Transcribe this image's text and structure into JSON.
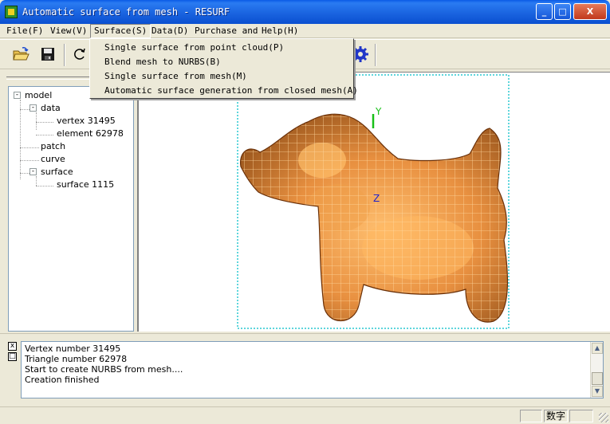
{
  "window": {
    "title": "Automatic surface from mesh - RESURF",
    "min_glyph": "_",
    "max_glyph": "□",
    "close_glyph": "X"
  },
  "menubar": {
    "items": [
      {
        "label": "File(F)"
      },
      {
        "label": "View(V)"
      },
      {
        "label": "Surface(S)"
      },
      {
        "label": "Data(D)"
      },
      {
        "label": "Purchase and"
      },
      {
        "label": "Help(H)"
      }
    ],
    "open_menu": "Surface(S)"
  },
  "surface_menu": {
    "items": [
      {
        "label": "Single surface from point cloud(P)"
      },
      {
        "label": "Blend mesh to NURBS(B)"
      },
      {
        "label": "Single surface from mesh(M)"
      },
      {
        "label": "Automatic surface generation from closed mesh(A)"
      }
    ]
  },
  "toolbar": {
    "buttons": [
      {
        "icon": "open-folder-icon"
      },
      {
        "icon": "save-disk-icon"
      },
      {
        "icon": "refresh-icon"
      },
      {
        "icon": "gear-icon"
      }
    ]
  },
  "tree": {
    "nodes": [
      {
        "label": "model",
        "expander": "-"
      },
      {
        "label": "data",
        "expander": "-"
      },
      {
        "label": "vertex 31495"
      },
      {
        "label": "element 62978"
      },
      {
        "label": "patch"
      },
      {
        "label": "curve"
      },
      {
        "label": "surface",
        "expander": "-"
      },
      {
        "label": "surface 1115"
      }
    ]
  },
  "viewport": {
    "axis_y": "Y",
    "axis_z": "Z",
    "colors": {
      "mesh": "#f0a04a",
      "mesh_dark": "#8a4a12",
      "selection_box": "#28c8d0",
      "axis_y": "#18c018",
      "axis_z": "#2020c8"
    }
  },
  "output": {
    "close_glyph": "x",
    "float_glyph": "□",
    "lines": [
      "Vertex number 31495",
      "Triangle number 62978",
      "Start to create NURBS from mesh....",
      "Creation finished"
    ]
  },
  "statusbar": {
    "num_label": "数字"
  }
}
